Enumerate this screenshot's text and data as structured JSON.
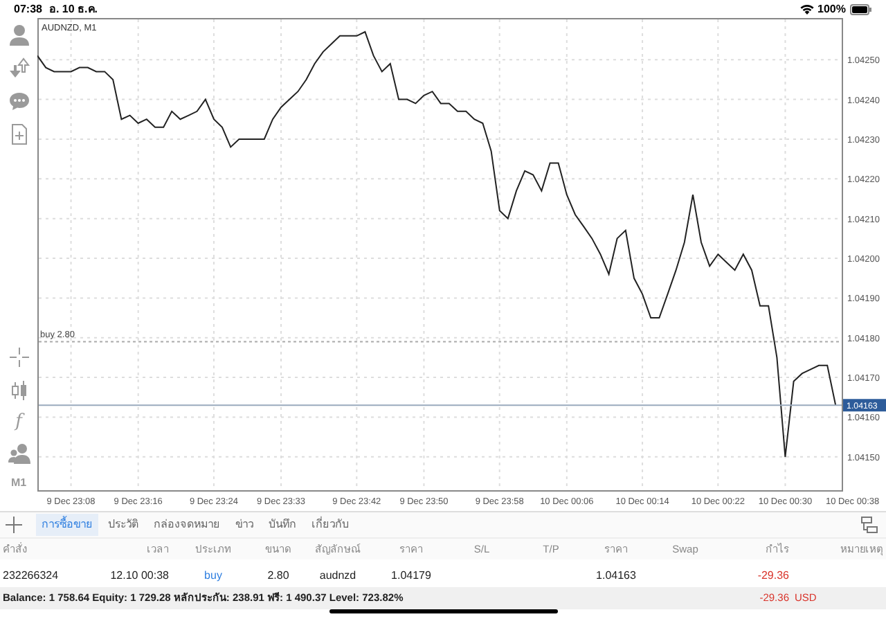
{
  "status_bar": {
    "time": "07:38",
    "date": "อ. 10 ธ.ค.",
    "battery": "100%"
  },
  "toolbar": {
    "function_label": "f",
    "timeframe": "M1"
  },
  "chart": {
    "chart_data": {
      "type": "line",
      "title": "AUDNZD, M1",
      "categories": [
        null,
        null,
        null,
        null,
        "9 Dec 23:08",
        null,
        null,
        null,
        null,
        null,
        null,
        null,
        "9 Dec 23:16",
        null,
        null,
        null,
        null,
        null,
        null,
        null,
        null,
        "9 Dec 23:24",
        null,
        null,
        null,
        null,
        null,
        null,
        null,
        "9 Dec 23:33",
        null,
        null,
        null,
        null,
        null,
        null,
        null,
        null,
        "9 Dec 23:42",
        null,
        null,
        null,
        null,
        null,
        null,
        null,
        "9 Dec 23:50",
        null,
        null,
        null,
        null,
        null,
        null,
        null,
        null,
        "9 Dec 23:58",
        null,
        null,
        null,
        null,
        null,
        null,
        null,
        "10 Dec 00:06",
        null,
        null,
        null,
        null,
        null,
        null,
        null,
        null,
        "10 Dec 00:14",
        null,
        null,
        null,
        null,
        null,
        null,
        null,
        null,
        "10 Dec 00:22",
        null,
        null,
        null,
        null,
        null,
        null,
        null,
        "10 Dec 00:30",
        null,
        null,
        null,
        null,
        null,
        null,
        null,
        "10 Dec 00:38"
      ],
      "series": [
        {
          "color": "#222222",
          "values": [
            1.04251,
            1.04248,
            1.04247,
            1.04247,
            1.04247,
            1.04248,
            1.04248,
            1.04247,
            1.04247,
            1.04245,
            1.04235,
            1.04236,
            1.04234,
            1.04235,
            1.04233,
            1.04233,
            1.04237,
            1.04235,
            1.04236,
            1.04237,
            1.0424,
            1.04235,
            1.04233,
            1.04228,
            1.0423,
            1.0423,
            1.0423,
            1.0423,
            1.04235,
            1.04238,
            1.0424,
            1.04242,
            1.04245,
            1.04249,
            1.04252,
            1.04254,
            1.04256,
            1.04256,
            1.04256,
            1.04257,
            1.04251,
            1.04247,
            1.04249,
            1.0424,
            1.0424,
            1.04239,
            1.04241,
            1.04242,
            1.04239,
            1.04239,
            1.04237,
            1.04237,
            1.04235,
            1.04234,
            1.04227,
            1.04212,
            1.0421,
            1.04217,
            1.04222,
            1.04221,
            1.04217,
            1.04224,
            1.04224,
            1.04216,
            1.04211,
            1.04208,
            1.04205,
            1.04201,
            1.04196,
            1.04205,
            1.04207,
            1.04195,
            1.04191,
            1.04185,
            1.04185,
            1.04191,
            1.04197,
            1.04204,
            1.04216,
            1.04204,
            1.04198,
            1.04201,
            1.04199,
            1.04197,
            1.04201,
            1.04197,
            1.04188,
            1.04188,
            1.04175,
            1.0415,
            1.04169,
            1.04171,
            1.04172,
            1.04173,
            1.04173,
            1.04163,
            null,
            null
          ]
        }
      ],
      "ylim": [
        1.041416,
        1.042605
      ],
      "yticks": [
        {
          "value": 1.0425,
          "label": "1.04250"
        },
        {
          "value": 1.0424,
          "label": "1.04240"
        },
        {
          "value": 1.0423,
          "label": "1.04230"
        },
        {
          "value": 1.0422,
          "label": "1.04220"
        },
        {
          "value": 1.0421,
          "label": "1.04210"
        },
        {
          "value": 1.042,
          "label": "1.04200"
        },
        {
          "value": 1.0419,
          "label": "1.04190"
        },
        {
          "value": 1.0418,
          "label": "1.04180"
        },
        {
          "value": 1.0417,
          "label": "1.04170"
        },
        {
          "value": 1.0416,
          "label": "1.04160"
        },
        {
          "value": 1.0415,
          "label": "1.04150"
        }
      ],
      "grid": true,
      "ref_lines": [
        {
          "axis": "y",
          "value": 1.04179,
          "label": "buy 2.80"
        },
        {
          "axis": "y",
          "value": 1.04163,
          "label": "1.04163"
        }
      ]
    }
  },
  "tabs": [
    {
      "label": "การซื้อขาย",
      "selected": true
    },
    {
      "label": "ประวัติ",
      "selected": false
    },
    {
      "label": "กล่องจดหมาย",
      "selected": false
    },
    {
      "label": "ข่าว",
      "selected": false
    },
    {
      "label": "บันทึก",
      "selected": false
    },
    {
      "label": "เกี่ยวกับ",
      "selected": false
    }
  ],
  "table": {
    "columns": [
      "คำสั่ง",
      "เวลา",
      "ประเภท",
      "ขนาด",
      "สัญลักษณ์",
      "ราคา",
      "S/L",
      "T/P",
      "ราคา",
      "Swap",
      "กำไร",
      "หมายเหตุ"
    ],
    "rows": [
      [
        "232266324",
        "12.10 00:38",
        "buy",
        "2.80",
        "audnzd",
        "1.04179",
        "",
        "",
        "1.04163",
        "",
        "-29.36",
        ""
      ]
    ]
  },
  "summary": {
    "text": "Balance: 1 758.64 Equity: 1 729.28 หลักประกัน: 238.91 ฟรี: 1 490.37 Level: 723.82%",
    "profit": "-29.36",
    "currency": "USD"
  }
}
